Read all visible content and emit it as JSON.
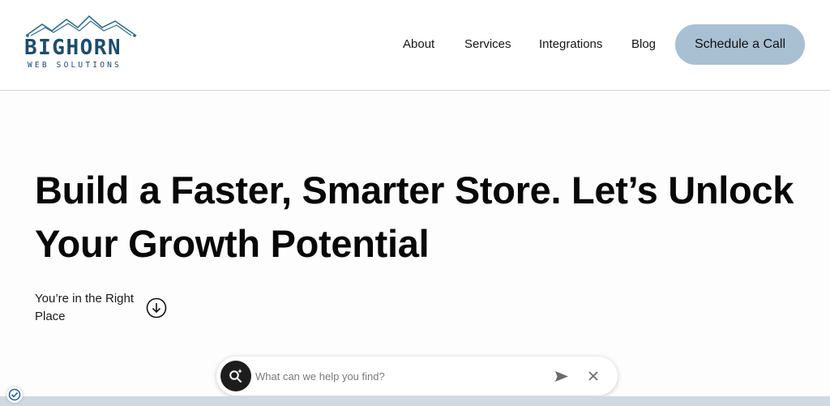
{
  "header": {
    "logo": {
      "wordmark": "BIGHORN",
      "tagline": "WEB SOLUTIONS",
      "icon": "mountain-logo-icon"
    },
    "nav": [
      {
        "label": "About"
      },
      {
        "label": "Services"
      },
      {
        "label": "Integrations"
      },
      {
        "label": "Blog"
      }
    ],
    "cta_label": "Schedule a Call"
  },
  "hero": {
    "title_line1": "Build a Faster, Smarter Store. Let’s Unlock",
    "title_line2": "Your Growth Potential",
    "subtitle_line1": "You’re in the Right",
    "subtitle_line2": "Place",
    "scroll_icon": "arrow-down-circle-icon"
  },
  "search": {
    "placeholder": "What can we help you find?",
    "search_icon": "ai-search-icon",
    "send_icon": "send-icon",
    "close_icon": "close-icon"
  },
  "badge": {
    "icon": "verified-check-icon"
  },
  "colors": {
    "brand": "#1c4c6e",
    "cta_bg": "#a9c0d3",
    "text": "#080808",
    "search_button": "#1d1d1d"
  }
}
